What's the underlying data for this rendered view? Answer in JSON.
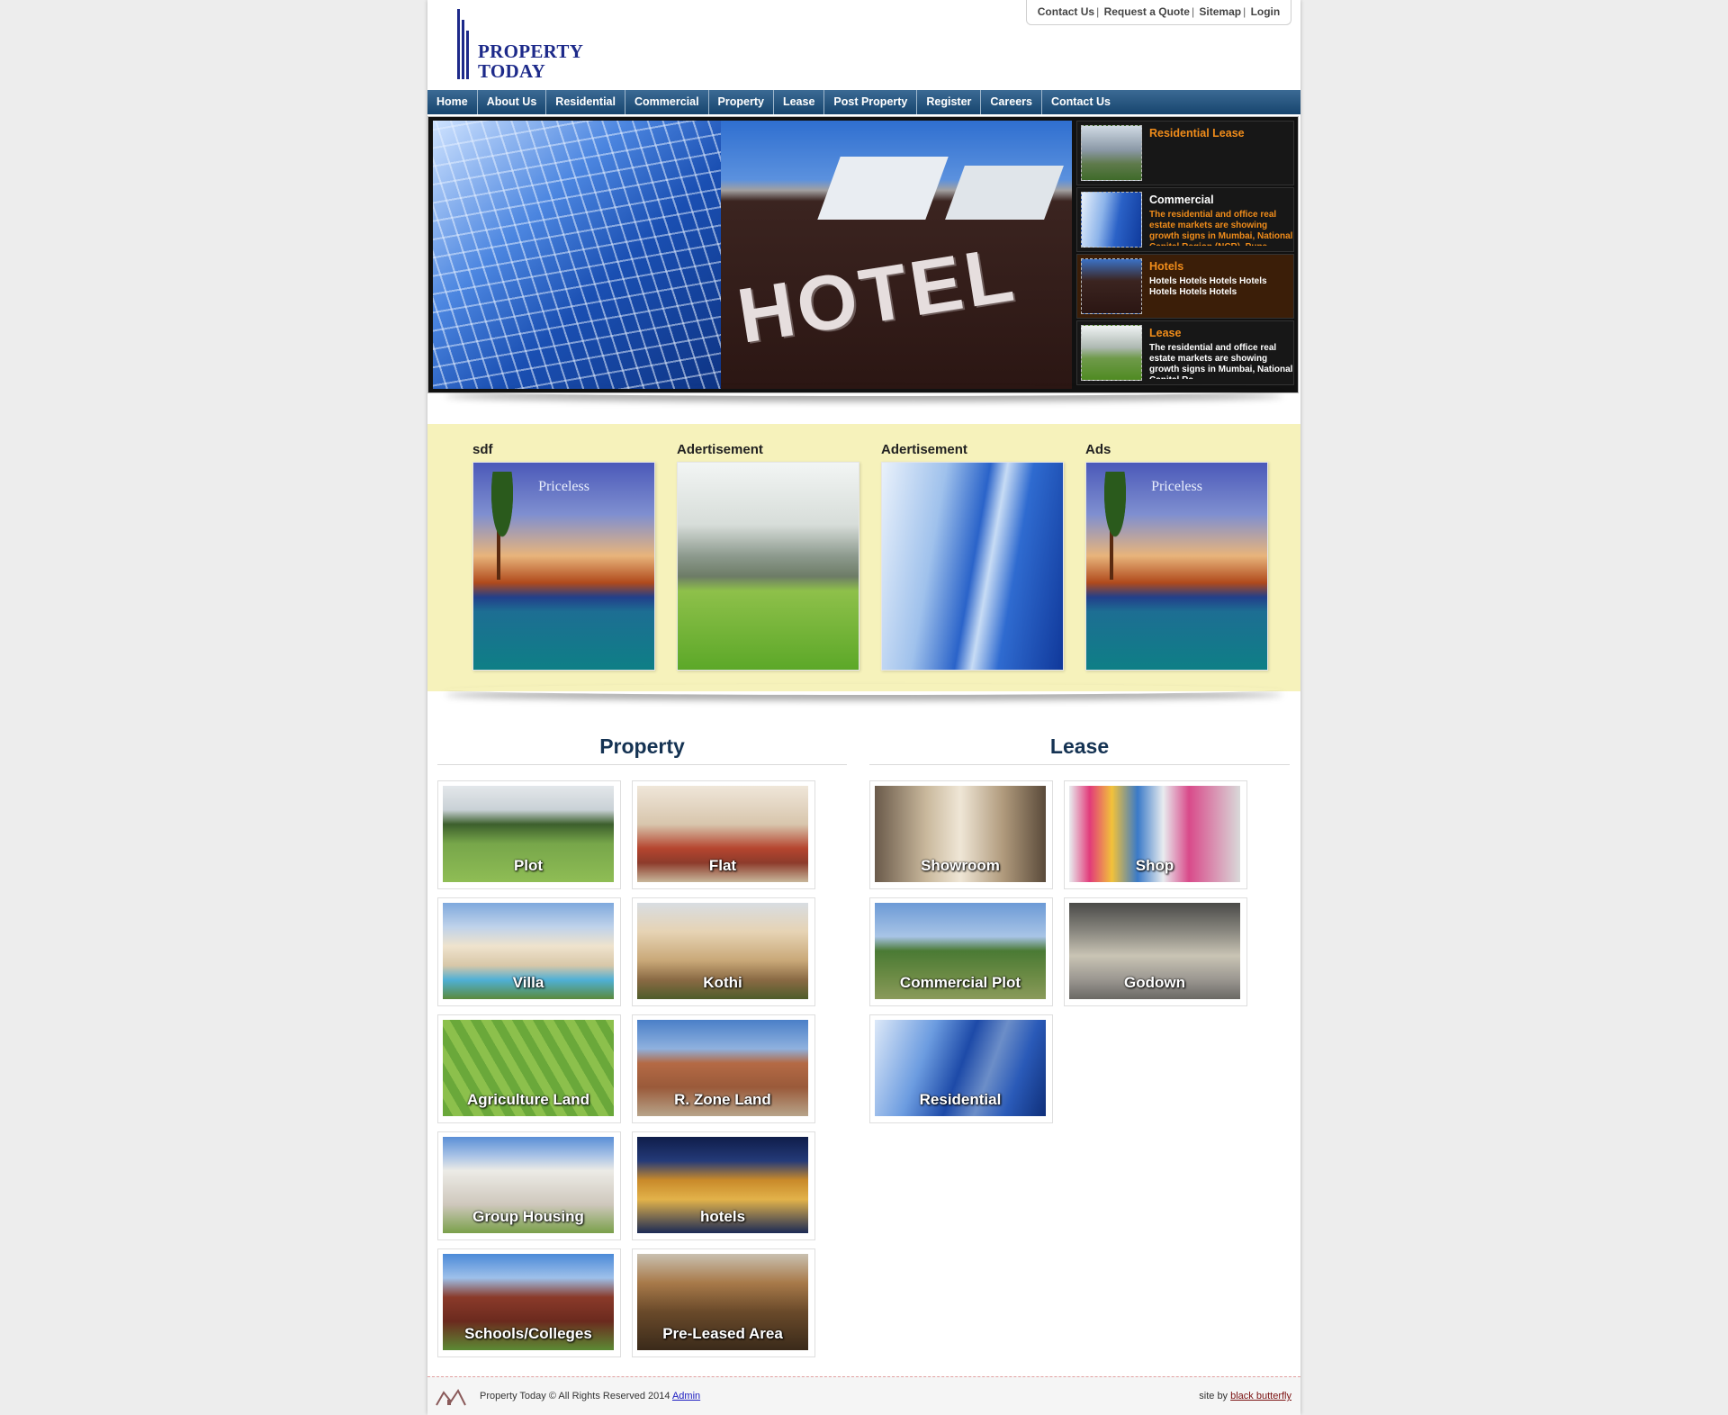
{
  "header": {
    "top_links": [
      "Contact Us",
      "Request a Quote",
      "Sitemap",
      "Login"
    ],
    "logo_line1": "PROPERTY",
    "logo_line2": "TODAY"
  },
  "nav": [
    "Home",
    "About Us",
    "Residential",
    "Commercial",
    "Property",
    "Lease",
    "Post Property",
    "Register",
    "Careers",
    "Contact Us"
  ],
  "slider": {
    "main_sign": "HOTEL",
    "tabs": [
      {
        "title": "Residential Lease",
        "desc": ""
      },
      {
        "title": "Commercial",
        "desc": "The residential and office real estate markets are showing growth signs in Mumbai, National Capital Region (NCR), Pune"
      },
      {
        "title": "Hotels",
        "desc": "Hotels Hotels Hotels Hotels Hotels Hotels Hotels"
      },
      {
        "title": "Lease",
        "desc": "The residential and office real estate markets are showing growth signs in Mumbai, National Capital Re"
      }
    ]
  },
  "ads": [
    {
      "label": "sdf",
      "image": "priceless-ad",
      "overlay": "Priceless"
    },
    {
      "label": "Adertisement",
      "image": "mountain-field",
      "overlay": ""
    },
    {
      "label": "Adertisement",
      "image": "glass-tower",
      "overlay": ""
    },
    {
      "label": "Ads",
      "image": "priceless-ad",
      "overlay": "Priceless"
    }
  ],
  "property": {
    "title": "Property",
    "items": [
      "Plot",
      "Flat",
      "Villa",
      "Kothi",
      "Agriculture Land",
      "R. Zone Land",
      "Group Housing",
      "hotels",
      "Schools/Colleges",
      "Pre-Leased Area"
    ]
  },
  "lease": {
    "title": "Lease",
    "items": [
      "Showroom",
      "Shop",
      "Commercial Plot",
      "Godown",
      "Residential"
    ]
  },
  "footer": {
    "copyright": "Property Today © All Rights Reserved 2014",
    "admin_link": "Admin",
    "site_by": "site by",
    "site_by_link": "black butterfly"
  }
}
